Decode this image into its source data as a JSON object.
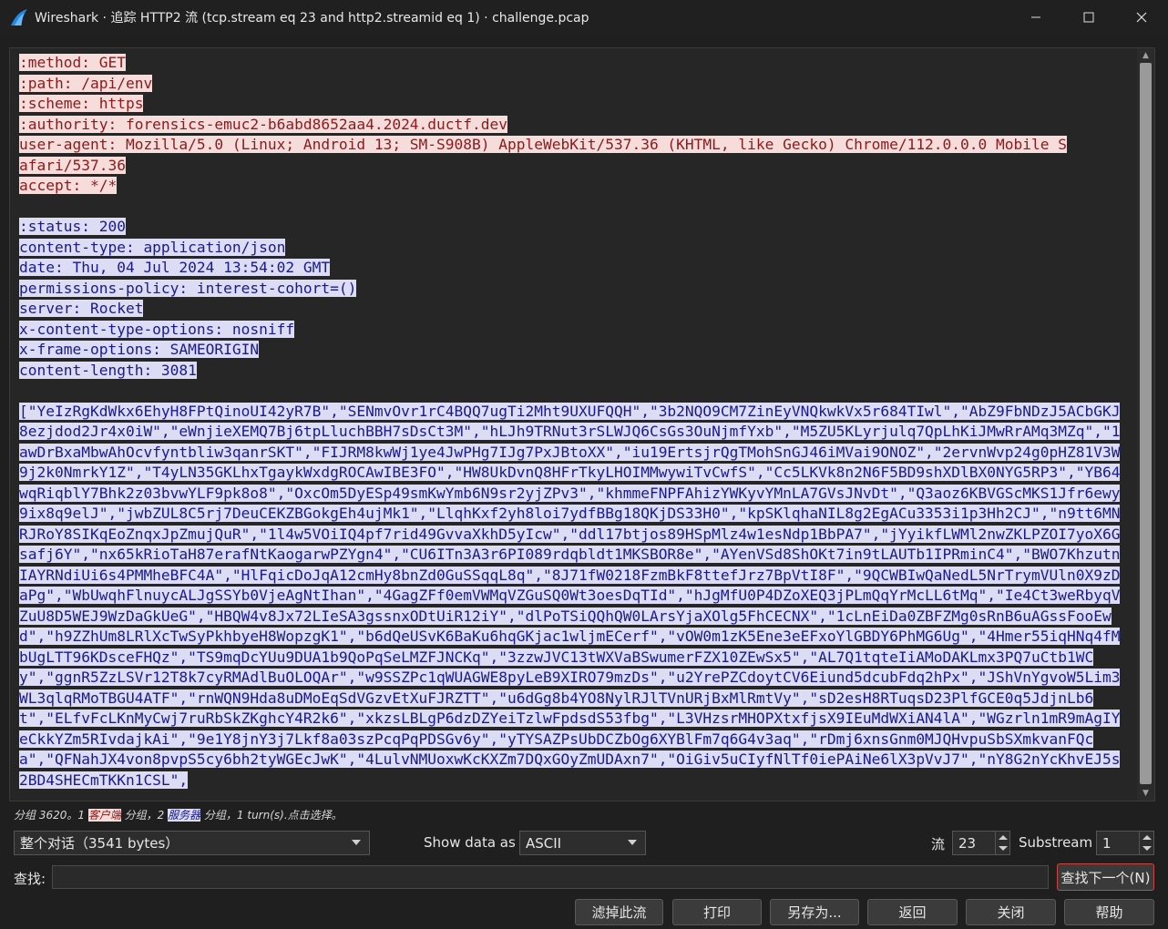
{
  "window": {
    "title": "Wireshark · 追踪 HTTP2 流 (tcp.stream eq 23 and http2.streamid eq 1) · challenge.pcap"
  },
  "stream": {
    "request_headers": [
      ":method: GET",
      ":path: /api/env",
      ":scheme: https",
      ":authority: forensics-emuc2-b6abd8652aa4.2024.ductf.dev",
      "user-agent: Mozilla/5.0 (Linux; Android 13; SM-S908B) AppleWebKit/537.36 (KHTML, like Gecko) Chrome/112.0.0.0 Mobile S",
      "afari/537.36",
      "accept: */*"
    ],
    "response_headers": [
      ":status: 200",
      "content-type: application/json",
      "date: Thu, 04 Jul 2024 13:54:02 GMT",
      "permissions-policy: interest-cohort=()",
      "server: Rocket",
      "x-content-type-options: nosniff",
      "x-frame-options: SAMEORIGIN",
      "content-length: 3081"
    ],
    "response_body": "[\"YeIzRgKdWkx6EhyH8FPtQinoUI42yR7B\",\"SENmvOvr1rC4BQQ7ugTi2Mht9UXUFQQH\",\"3b2NQO9CM7ZinEyVNQkwkVx5r684TIwl\",\"AbZ9FbNDzJ5ACbGKJ8ezjdod2Jr4x0iW\",\"eWnjieXEMQ7Bj6tpLluchBBH7sDsCt3M\",\"hLJh9TRNut3rSLWJQ6CsGs3OuNjmfYxb\",\"M5ZU5KLyrjulq7QpLhKiJMwRrAMq3MZq\",\"1awDrBxaMbwAhOcvfyntbliw3qanrSKT\",\"FIJRM8kwWj1ye4JwPHg7IJg7PxJBtoXX\",\"iu19ErtsjrQgTMohSnGJ46iMVai9ONOZ\",\"2ervnWvp24g0pHZ81V3W9j2k0NmrkY1Z\",\"T4yLN35GKLhxTgaykWxdgROCAwIBE3FO\",\"HW8UkDvnQ8HFrTkyLHOIMMwywiTvCwfS\",\"Cc5LKVk8n2N6F5BD9shXDlBX0NYG5RP3\",\"YB64wqRiqblY7Bhk2z03bvwYLF9pk8o8\",\"OxcOm5DyESp49smKwYmb6N9sr2yjZPv3\",\"khmmeFNPFAhizYWKyvYMnLA7GVsJNvDt\",\"Q3aoz6KBVGScMKS1Jfr6ewy9ix8q9elJ\",\"jwbZUL8C5rj7DeuCEKZBGokgEh4ujMk1\",\"LlqhKxf2yh8loi7ydfBBg18QKjDS33H0\",\"kpSKlqhaNIL8g2EgACu3353i1p3Hh2CJ\",\"n9tt6MNRJRoY8SIKqEoZnqxJpZmujQuR\",\"1l4w5VOiIQ4pf7rid49GvvaXkhD5yIcw\",\"ddl17btjos89HSpMlz4w1esNdp1BbPA7\",\"jYyikfLWMl2nwZKLPZOI7yoX6Gsafj6Y\",\"nx65kRioTaH87erafNtKaogarwPZYgn4\",\"CU6ITn3A3r6PI089rdqbldt1MKSBOR8e\",\"AYenVSd8ShOKt7in9tLAUTb1IPRminC4\",\"BWO7KhzutnIAYRNdiUi6s4PMMheBFC4A\",\"HlFqicDoJqA12cmHy8bnZd0GuSSqqL8q\",\"8J71fW0218FzmBkF8ttefJrz7BpVtI8F\",\"9QCWBIwQaNedL5NrTrymVUln0X9zDaPg\",\"WbUwqhFlnuycALJgSSYb0VjeAgNtIhan\",\"4GagZFf0emVWMqVZGuSQ0Wt3oesDqTId\",\"hJgMfU0P4DZoXEQ3jPLmQqYrMcLL6tMq\",\"Ie4Ct3weRbyqVZuU8D5WEJ9WzDaGkUeG\",\"HBQW4v8Jx72LIeSA3gssnxODtUiR12iY\",\"dlPoTSiQQhQW0LArsYjaXOlg5FhCECNX\",\"1cLnEiDa0ZBFZMg0sRnB6uAGssFooEwd\",\"h9ZZhUm8LRlXcTwSyPkhbyeH8WopzgK1\",\"b6dQeUSvK6BaKu6hqGKjac1wljmECerf\",\"vOW0m1zK5Ene3eEFxoYlGBDY6PhMG6Ug\",\"4Hmer55iqHNq4fMbUgLTT96KDsceFHQz\",\"TS9mqDcYUu9DUA1b9QoPqSeLMZFJNCKq\",\"3zzwJVC13tWXVaBSwumerFZX10ZEwSx5\",\"AL7Q1tqteIiAMoDAKLmx3PQ7uCtb1WCy\",\"ggnR5ZzLSVr12T8k7cyRMAdlBuOLOQAr\",\"w9SSZPc1qWUAGWE8pyLeB9XIRO79mzDs\",\"u2YrePZCdoytCV6Eiund5dcubFdq2hPx\",\"JShVnYgvoW5Lim3WL3qlqRMoTBGU4ATF\",\"rnWQN9Hda8uDMoEqSdVGzvEtXuFJRZTT\",\"u6dGg8b4YO8NylRJlTVnURjBxMlRmtVy\",\"sD2esH8RTuqsD23PlfGCE0q5JdjnLb6t\",\"ELfvFcLKnMyCwj7ruRbSkZKghcY4R2k6\",\"xkzsLBLgP6dzDZYeiTzlwFpdsdS53fbg\",\"L3VHzsrMHOPXtxfjsX9IEuMdWXiAN4lA\",\"WGzrln1mR9mAgIYeCkkYZm5RIvdajkAi\",\"9e1Y8jnY3j7Lkf8a03szPcqPqPDSGv6y\",\"yTYSAZPsUbDCZbOg6XYBlFm7q6G4v3aq\",\"rDmj6xnsGnm0MJQHvpuSbSXmkvanFQca\",\"QFNahJX4von8pvpS5cy6bh2tyWGEcJwK\",\"4LulvNMUoxwKcKXZm7DQxGOyZmUDAxn7\",\"OiGiv5uCIyfNlTf0iePAiNe6lX3pVvJ7\",\"nY8G2nYcKhvEJ5s2BD4SHECmTKKn1CSL\","
  },
  "status_line": {
    "prefix": "分组 3620。1 ",
    "client_tag": "客户端",
    "middle": " 分组，2 ",
    "server_tag": "服务器",
    "suffix": " 分组，1 turn(s).点击选择。"
  },
  "controls": {
    "conversation_select": "整个对话（3541 bytes）",
    "show_data_as_label": "Show data as",
    "show_data_as_value": "ASCII",
    "stream_label": "流",
    "stream_value": "23",
    "substream_label": "Substream",
    "substream_value": "1"
  },
  "find": {
    "label": "查找:",
    "value": "",
    "next_button": "查找下一个(N)"
  },
  "buttons": {
    "filter_out": "滤掉此流",
    "print": "打印",
    "save_as": "另存为...",
    "back": "返回",
    "close": "关闭",
    "help": "帮助"
  },
  "colors": {
    "client_bg": "#f7dcdc",
    "client_fg": "#8b1a1a",
    "server_bg": "#dcdcf4",
    "server_fg": "#1a1a8b",
    "window_bg": "#1f1f1f",
    "app_icon": "#1e88e5"
  },
  "icons": [
    "wireshark-fin-icon",
    "minimize-icon",
    "maximize-icon",
    "close-icon"
  ]
}
